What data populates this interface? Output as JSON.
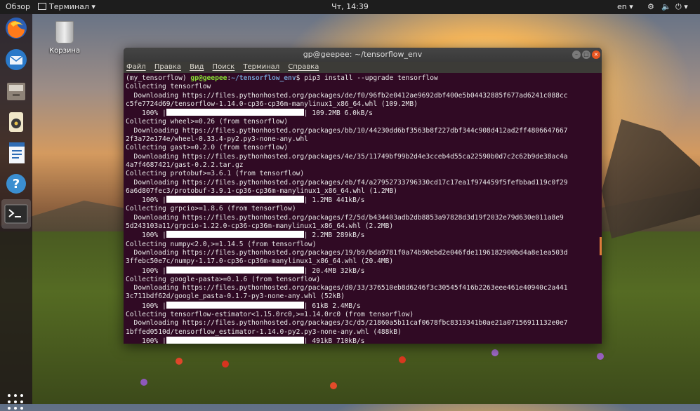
{
  "topbar": {
    "overview": "Обзор",
    "app_menu": "Терминал ▾",
    "clock": "Чт, 14:39",
    "lang": "en ▾",
    "power": "⏻ ▾"
  },
  "desktop": {
    "trash_label": "Корзина"
  },
  "terminal": {
    "title": "gp@geepee: ~/tensorflow_env",
    "menu": [
      "Файл",
      "Правка",
      "Вид",
      "Поиск",
      "Терминал",
      "Справка"
    ],
    "prompt_env": "(my_tensorflow) ",
    "prompt_user": "gp@geepee",
    "prompt_sep": ":",
    "prompt_path": "~/tensorflow_env",
    "prompt_cmd": "$ pip3 install --upgrade tensorflow",
    "lines": [
      {
        "t": "text",
        "v": "Collecting tensorflow"
      },
      {
        "t": "text",
        "v": "  Downloading https://files.pythonhosted.org/packages/de/f0/96fb2e0412ae9692dbf400e5b04432885f677ad6241c088cc"
      },
      {
        "t": "text",
        "v": "c5fe7724d69/tensorflow-1.14.0-cp36-cp36m-manylinux1_x86_64.whl (109.2MB)"
      },
      {
        "t": "bar",
        "pre": "    100% |",
        "post": "| 109.2MB 6.0kB/s"
      },
      {
        "t": "text",
        "v": "Collecting wheel>=0.26 (from tensorflow)"
      },
      {
        "t": "text",
        "v": "  Downloading https://files.pythonhosted.org/packages/bb/10/44230dd6bf3563b8f227dbf344c908d412ad2ff4806647667"
      },
      {
        "t": "text",
        "v": "2f3a72e174e/wheel-0.33.4-py2.py3-none-any.whl"
      },
      {
        "t": "text",
        "v": "Collecting gast>=0.2.0 (from tensorflow)"
      },
      {
        "t": "text",
        "v": "  Downloading https://files.pythonhosted.org/packages/4e/35/11749bf99b2d4e3cceb4d55ca22590b0d7c2c62b9de38ac4a"
      },
      {
        "t": "text",
        "v": "4a7f4687421/gast-0.2.2.tar.gz"
      },
      {
        "t": "text",
        "v": "Collecting protobuf>=3.6.1 (from tensorflow)"
      },
      {
        "t": "text",
        "v": "  Downloading https://files.pythonhosted.org/packages/eb/f4/a27952733796330cd17c17ea1f974459f5fefbbad119c0f29"
      },
      {
        "t": "text",
        "v": "6a6d807fec3/protobuf-3.9.1-cp36-cp36m-manylinux1_x86_64.whl (1.2MB)"
      },
      {
        "t": "bar",
        "pre": "    100% |",
        "post": "| 1.2MB 441kB/s"
      },
      {
        "t": "text",
        "v": "Collecting grpcio>=1.8.6 (from tensorflow)"
      },
      {
        "t": "text",
        "v": "  Downloading https://files.pythonhosted.org/packages/f2/5d/b434403adb2db8853a97828d3d19f2032e79d630e011a8e9"
      },
      {
        "t": "text",
        "v": "5d243103a11/grpcio-1.22.0-cp36-cp36m-manylinux1_x86_64.whl (2.2MB)"
      },
      {
        "t": "bar",
        "pre": "    100% |",
        "post": "| 2.2MB 289kB/s"
      },
      {
        "t": "text",
        "v": "Collecting numpy<2.0,>=1.14.5 (from tensorflow)"
      },
      {
        "t": "text",
        "v": "  Downloading https://files.pythonhosted.org/packages/19/b9/bda9781f0a74b90ebd2e046fde1196182900bd4a8e1ea503d"
      },
      {
        "t": "text",
        "v": "3ffebc50e7c/numpy-1.17.0-cp36-cp36m-manylinux1_x86_64.whl (20.4MB)"
      },
      {
        "t": "bar",
        "pre": "    100% |",
        "post": "| 20.4MB 32kB/s"
      },
      {
        "t": "text",
        "v": "Collecting google-pasta>=0.1.6 (from tensorflow)"
      },
      {
        "t": "text",
        "v": "  Downloading https://files.pythonhosted.org/packages/d0/33/376510eb8d6246f3c30545f416b2263eee461e40940c2a441"
      },
      {
        "t": "text",
        "v": "3c711bdf62d/google_pasta-0.1.7-py3-none-any.whl (52kB)"
      },
      {
        "t": "bar",
        "pre": "    100% |",
        "post": "| 61kB 2.4MB/s"
      },
      {
        "t": "text",
        "v": "Collecting tensorflow-estimator<1.15.0rc0,>=1.14.0rc0 (from tensorflow)"
      },
      {
        "t": "text",
        "v": "  Downloading https://files.pythonhosted.org/packages/3c/d5/21860a5b11caf0678fbc8319341b0ae21a07156911132e0e7"
      },
      {
        "t": "text",
        "v": "1bffed0510d/tensorflow_estimator-1.14.0-py2.py3-none-any.whl (488kB)"
      },
      {
        "t": "bar",
        "pre": "    100% |",
        "post": "| 491kB 710kB/s"
      }
    ]
  },
  "dock": [
    {
      "name": "firefox-icon",
      "color": "#e66000"
    },
    {
      "name": "thunderbird-icon",
      "color": "#2a79c9"
    },
    {
      "name": "files-icon",
      "color": "#9a8f80"
    },
    {
      "name": "rhythmbox-icon",
      "color": "#e7c24b"
    },
    {
      "name": "writer-icon",
      "color": "#2f6db5"
    },
    {
      "name": "help-icon",
      "color": "#3b8ed0"
    },
    {
      "name": "terminal-icon",
      "color": "#2c2c2c"
    }
  ]
}
